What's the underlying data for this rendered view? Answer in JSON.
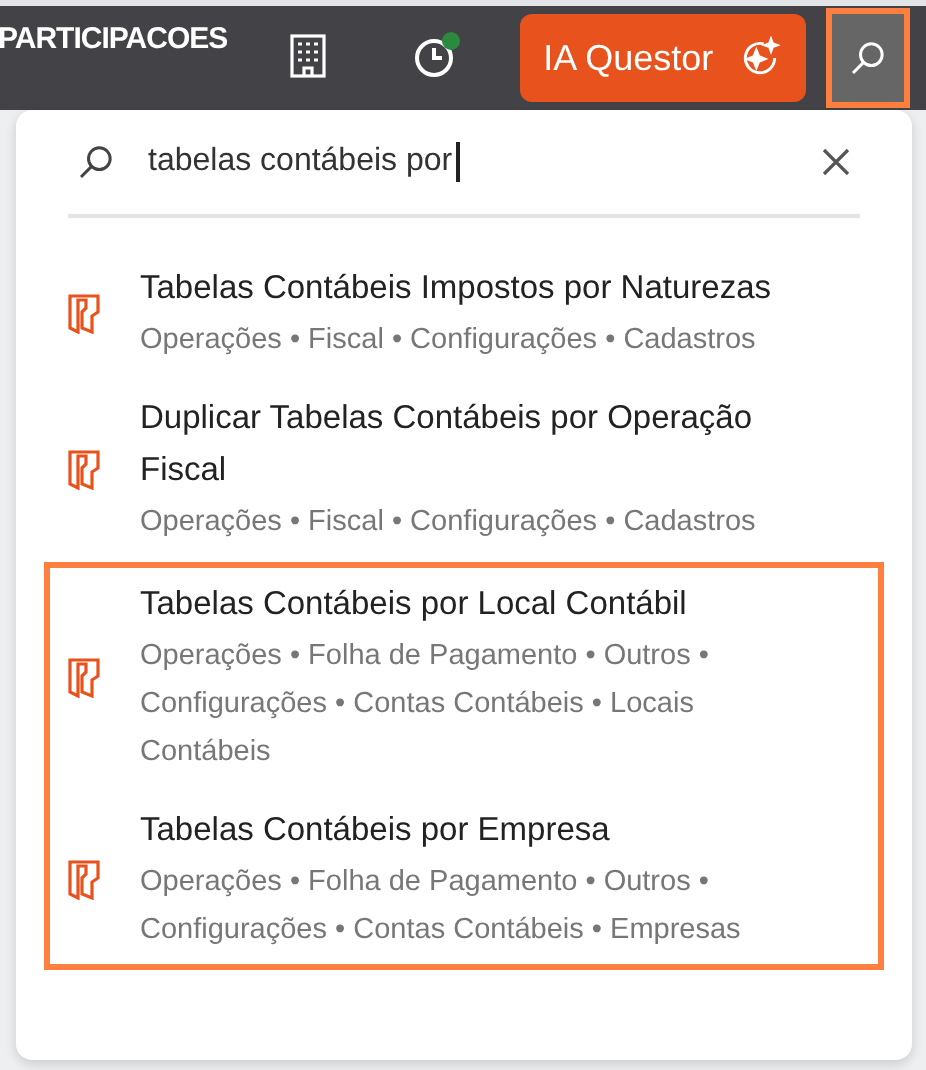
{
  "top_bar": {
    "company": "PARTICIPACOES",
    "ai_button": {
      "label": "IA Questor"
    },
    "history_badge": {
      "on": true
    },
    "search_button": {
      "highlighted": true
    }
  },
  "search": {
    "value": "tabelas contábeis por"
  },
  "results": [
    {
      "title": "Tabelas Contábeis Impostos por Naturezas",
      "path": "Operações • Fiscal • Configurações • Cadastros",
      "highlighted": false
    },
    {
      "title": "Duplicar Tabelas Contábeis por Operação Fiscal",
      "path": "Operações • Fiscal • Configurações • Cadastros",
      "highlighted": false
    },
    {
      "title": "Tabelas Contábeis por Local Contábil",
      "path": "Operações • Folha de Pagamento • Outros • Configurações • Contas Contábeis • Locais Contábeis",
      "highlighted": true
    },
    {
      "title": "Tabelas Contábeis por Empresa",
      "path": "Operações • Folha de Pagamento • Outros • Configurações • Contas Contábeis • Empresas",
      "highlighted": true
    }
  ]
}
